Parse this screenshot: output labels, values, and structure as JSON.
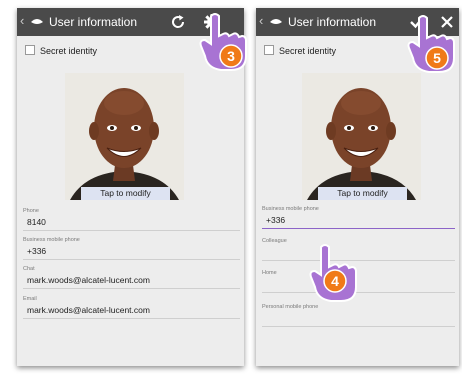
{
  "left_screen": {
    "title": "User information",
    "secret_identity_label": "Secret identity",
    "photo_caption": "Tap to modify",
    "fields": [
      {
        "label": "Phone",
        "value": "8140"
      },
      {
        "label": "Business mobile phone",
        "value": "+336"
      },
      {
        "label": "Chat",
        "value": "mark.woods@alcatel-lucent.com"
      },
      {
        "label": "Email",
        "value": "mark.woods@alcatel-lucent.com"
      }
    ],
    "icons": [
      "back-icon",
      "app-icon",
      "refresh-icon",
      "gear-icon"
    ],
    "step_badge": "3"
  },
  "right_screen": {
    "title": "User information",
    "secret_identity_label": "Secret identity",
    "photo_caption": "Tap to modify",
    "fields": [
      {
        "label": "Business mobile phone",
        "value": "+336"
      },
      {
        "label": "Colleague",
        "value": ""
      },
      {
        "label": "Home",
        "value": ""
      },
      {
        "label": "Personal mobile phone",
        "value": ""
      }
    ],
    "icons": [
      "back-icon",
      "app-icon",
      "check-icon",
      "close-icon"
    ],
    "step_badges": [
      "5",
      "4"
    ]
  },
  "colors": {
    "titlebar": "#4a4a4a",
    "hand_fill": "#a873d3",
    "badge_fill": "#f07a18",
    "active_underline": "#8c64c8"
  }
}
